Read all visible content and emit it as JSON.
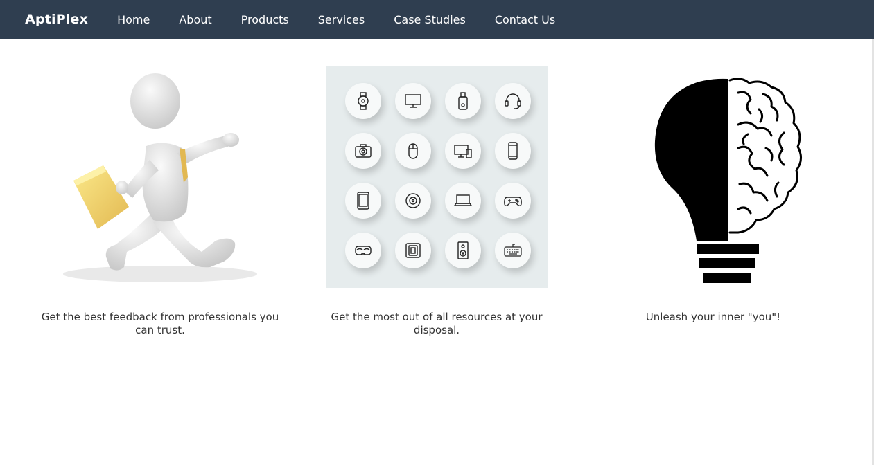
{
  "nav": {
    "brand": "AptiPlex",
    "links": [
      "Home",
      "About",
      "Products",
      "Services",
      "Case Studies",
      "Contact Us"
    ]
  },
  "features": [
    {
      "caption": "Get the best feedback from professionals you can trust.",
      "image": "running-figure-with-folder"
    },
    {
      "caption": "Get the most out of all resources at your disposal.",
      "image": "device-icons-grid"
    },
    {
      "caption": "Unleash your inner \"you\"!",
      "image": "lightbulb-brain"
    }
  ],
  "device_icons": [
    "smartwatch-icon",
    "monitor-icon",
    "usb-drive-icon",
    "headset-icon",
    "camera-icon",
    "mouse-icon",
    "devices-icon",
    "smartphone-icon",
    "tablet-icon",
    "disc-icon",
    "laptop-icon",
    "gamepad-icon",
    "vr-headset-icon",
    "tablet-case-icon",
    "speaker-icon",
    "keyboard-icon"
  ],
  "colors": {
    "navbar": "#2f3e50",
    "nav_text": "#ffffff",
    "caption_text": "#333333",
    "grid_background": "#e6eced"
  }
}
